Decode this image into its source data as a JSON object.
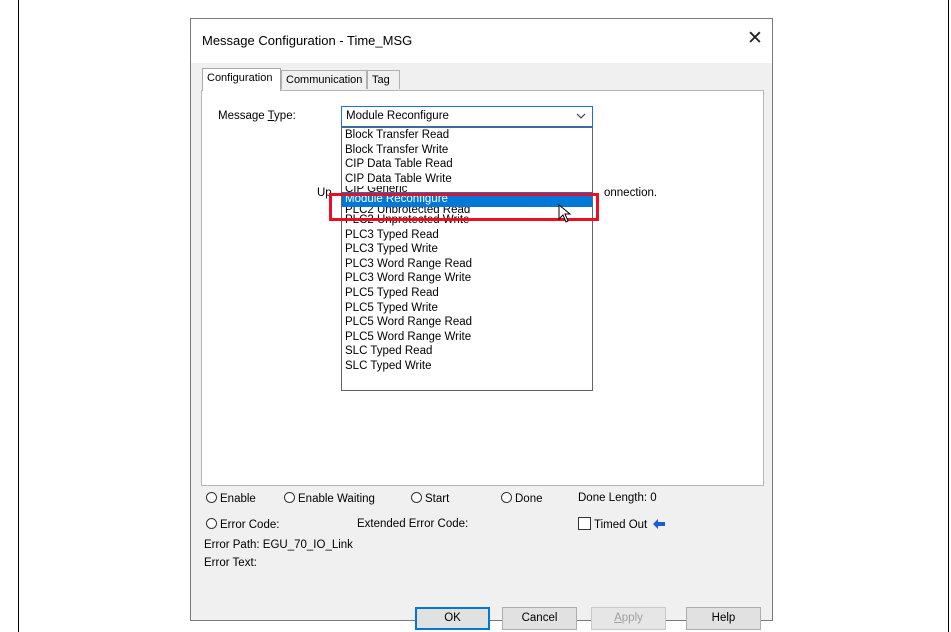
{
  "dialog": {
    "title": "Message Configuration - Time_MSG",
    "close_glyph": "✕"
  },
  "tabs": [
    {
      "label": "Configuration",
      "active": true
    },
    {
      "label": "Communication",
      "active": false
    },
    {
      "label": "Tag",
      "active": false
    }
  ],
  "config": {
    "message_type_label_pre": "Message ",
    "message_type_label_ul": "T",
    "message_type_label_post": "ype:",
    "message_type_value": "Module Reconfigure",
    "behind_text_left": "Up",
    "behind_text_right": "onnection."
  },
  "dropdown": {
    "items": [
      "Block Transfer Read",
      "Block Transfer Write",
      "CIP Data Table Read",
      "CIP Data Table Write",
      "CIP Generic",
      "Module Reconfigure",
      "PLC2 Unprotected Read",
      "PLC2 Unprotected Write",
      "PLC3 Typed Read",
      "PLC3 Typed Write",
      "PLC3 Word Range Read",
      "PLC3 Word Range Write",
      "PLC5 Typed Read",
      "PLC5 Typed Write",
      "PLC5 Word Range Read",
      "PLC5 Word Range Write",
      "SLC Typed Read",
      "SLC Typed Write"
    ],
    "highlighted": "Module Reconfigure"
  },
  "status": {
    "enable": "Enable",
    "enable_waiting": "Enable Waiting",
    "start": "Start",
    "done": "Done",
    "done_length": "Done Length: 0",
    "error_code": "Error Code:",
    "extended_error_code": "Extended Error Code:",
    "timed_out": "Timed Out",
    "error_path": "Error Path: EGU_70_IO_Link",
    "error_text": "Error Text:"
  },
  "buttons": {
    "ok": "OK",
    "cancel": "Cancel",
    "apply_ul": "A",
    "apply_rest": "pply",
    "help": "Help"
  },
  "colors": {
    "highlight": "#0078d7",
    "annotation_red": "#e81123",
    "arrow_blue": "#1a5bd8"
  }
}
